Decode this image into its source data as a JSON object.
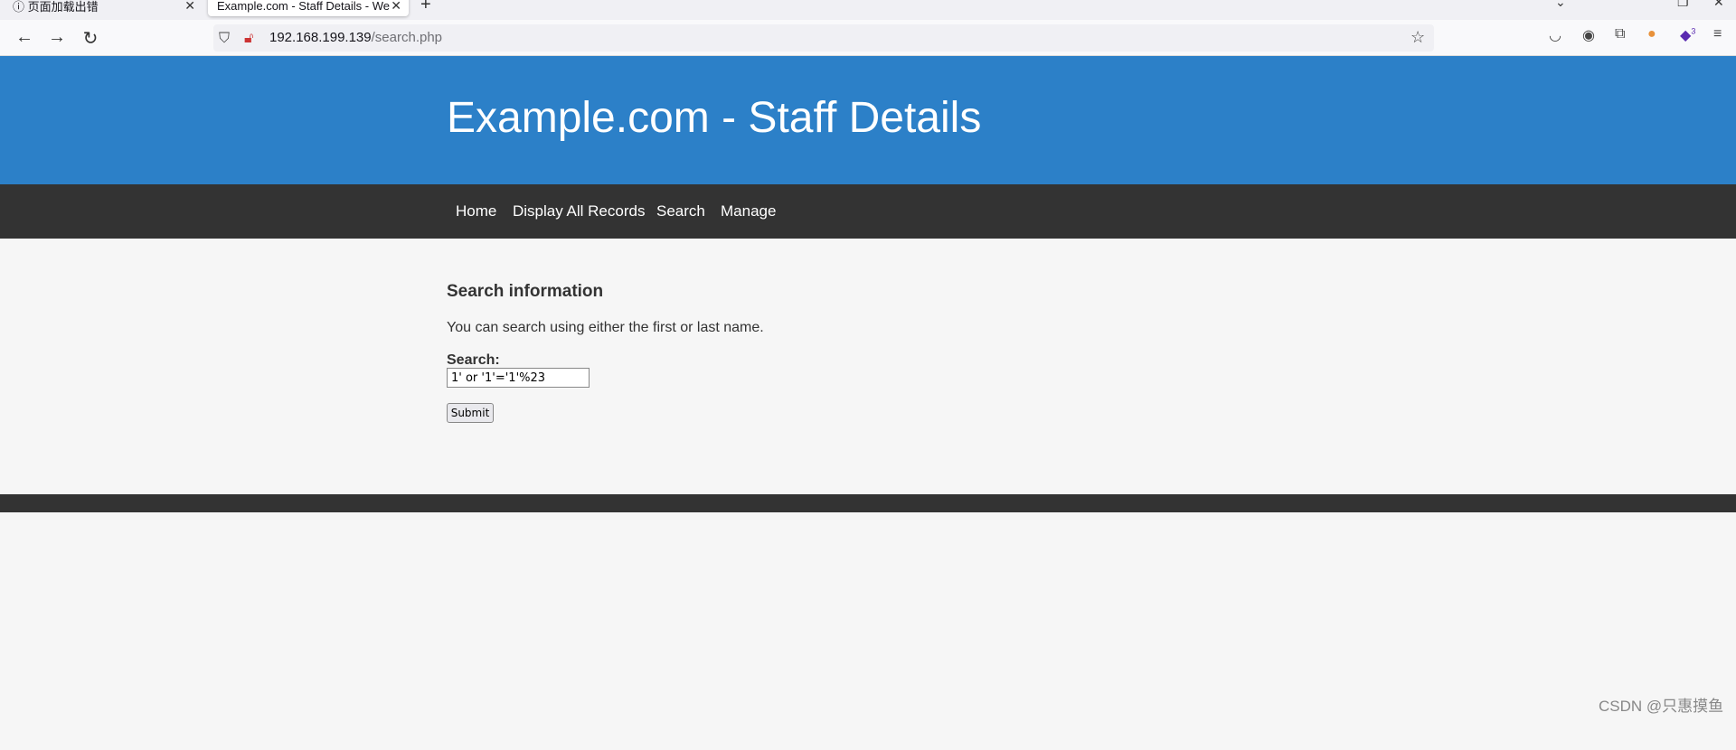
{
  "browser": {
    "tabs": [
      {
        "label": "页面加载出错"
      },
      {
        "label": "Example.com - Staff Details - We"
      }
    ],
    "url_host": "192.168.199.139",
    "url_path": "/search.php",
    "extension_badge": "3"
  },
  "header": {
    "title": "Example.com - Staff Details"
  },
  "nav": {
    "items": [
      {
        "label": "Home"
      },
      {
        "label": "Display All Records"
      },
      {
        "label": "Search"
      },
      {
        "label": "Manage"
      }
    ]
  },
  "main": {
    "heading": "Search information",
    "description": "You can search using either the first or last name.",
    "search_label": "Search:",
    "search_value": "1' or '1'='1'%23",
    "submit_label": "Submit"
  },
  "colors": {
    "header": "#2c80c8",
    "nav": "#333333"
  },
  "watermark": "CSDN @只惠摸鱼"
}
